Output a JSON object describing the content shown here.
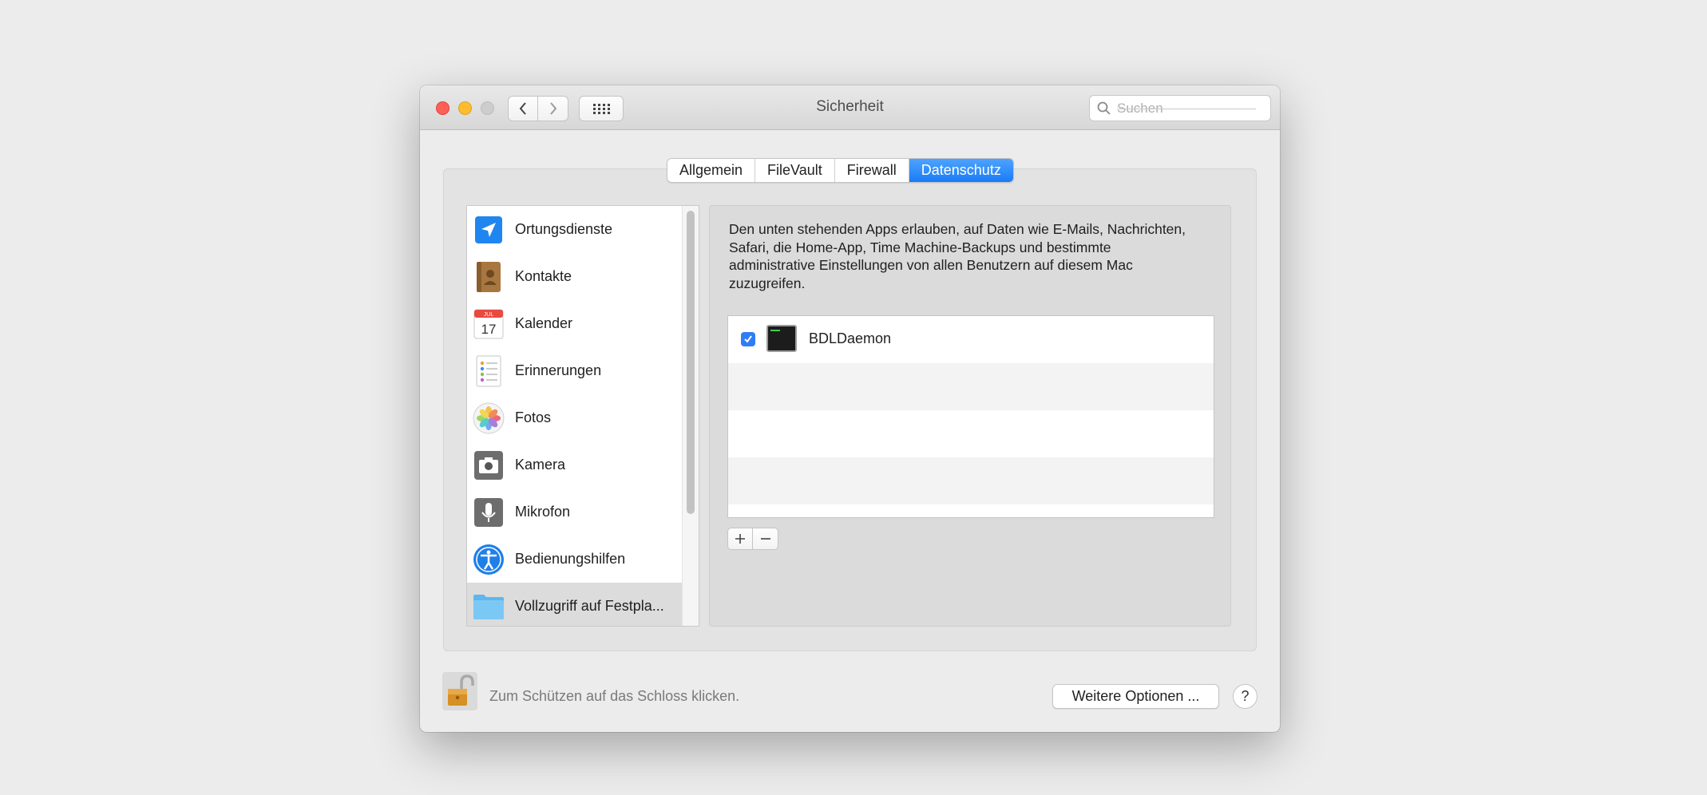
{
  "window": {
    "title": "Sicherheit",
    "search_placeholder": "Suchen"
  },
  "tabs": [
    {
      "label": "Allgemein",
      "active": false
    },
    {
      "label": "FileVault",
      "active": false
    },
    {
      "label": "Firewall",
      "active": false
    },
    {
      "label": "Datenschutz",
      "active": true
    }
  ],
  "sidebar": {
    "items": [
      {
        "label": "Ortungsdienste",
        "icon": "location-arrow-icon"
      },
      {
        "label": "Kontakte",
        "icon": "contacts-book-icon"
      },
      {
        "label": "Kalender",
        "icon": "calendar-icon",
        "calendar_month": "JUL",
        "calendar_day": "17"
      },
      {
        "label": "Erinnerungen",
        "icon": "reminders-icon"
      },
      {
        "label": "Fotos",
        "icon": "photos-icon"
      },
      {
        "label": "Kamera",
        "icon": "camera-icon"
      },
      {
        "label": "Mikrofon",
        "icon": "microphone-icon"
      },
      {
        "label": "Bedienungshilfen",
        "icon": "accessibility-icon"
      },
      {
        "label": "Vollzugriff auf Festpla...",
        "icon": "folder-icon",
        "selected": true
      }
    ]
  },
  "detail": {
    "description": "Den unten stehenden Apps erlauben, auf Daten wie E-Mails, Nachrichten, Safari, die Home-App, Time Machine-Backups und bestimmte administrative Einstellungen von allen Benutzern auf diesem Mac zuzugreifen.",
    "apps": [
      {
        "name": "BDLDaemon",
        "checked": true,
        "icon": "terminal-icon"
      }
    ],
    "add_symbol": "+",
    "remove_symbol": "−"
  },
  "footer": {
    "lock_text": "Zum Schützen auf das Schloss klicken.",
    "more_options_label": "Weitere Optionen ...",
    "help_label": "?"
  },
  "colors": {
    "accent": "#1a7cf5",
    "close": "#fe5f57",
    "minimize": "#febc2e"
  }
}
